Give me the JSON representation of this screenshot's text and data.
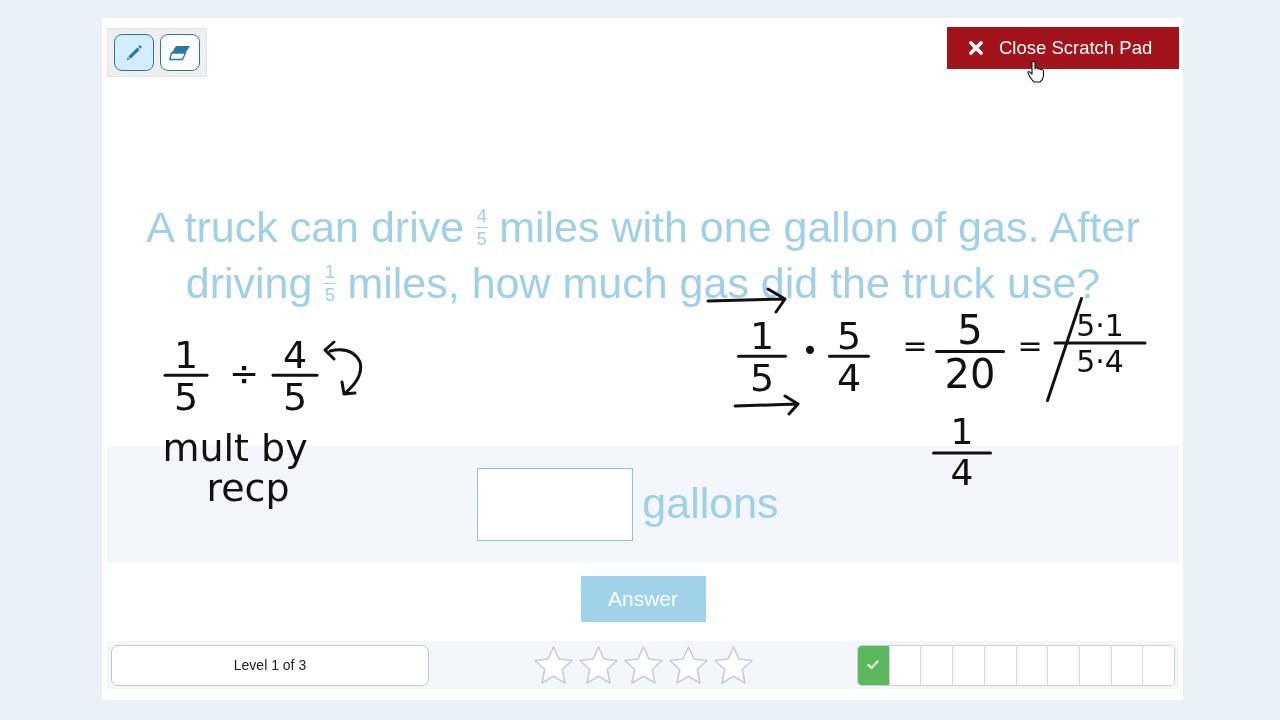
{
  "toolbar": {
    "tools": [
      {
        "kind": "pencil",
        "selected": true
      },
      {
        "kind": "eraser",
        "selected": false
      }
    ]
  },
  "close_button": {
    "label": "Close Scratch Pad"
  },
  "question": [
    {
      "kind": "text",
      "text": "A truck can drive"
    },
    {
      "kind": "fraction",
      "numerator": "4",
      "denominator": "5"
    },
    {
      "kind": "text",
      "text": "miles with one gallon of gas. After driving"
    },
    {
      "kind": "fraction",
      "numerator": "1",
      "denominator": "5"
    },
    {
      "kind": "text",
      "text": "miles, how much gas did the truck use?"
    }
  ],
  "scratch_work": [
    {
      "kind": "fraction",
      "numerator": "1",
      "denominator": "5"
    },
    {
      "kind": "symbol",
      "text": "÷"
    },
    {
      "kind": "fraction",
      "numerator": "4",
      "denominator": "5"
    },
    {
      "kind": "note",
      "text": "mult by"
    },
    {
      "kind": "note",
      "text": "recp"
    },
    {
      "kind": "fraction",
      "numerator": "1",
      "denominator": "5"
    },
    {
      "kind": "symbol",
      "text": "•"
    },
    {
      "kind": "fraction",
      "numerator": "5",
      "denominator": "4"
    },
    {
      "kind": "symbol",
      "text": "="
    },
    {
      "kind": "fraction",
      "numerator": "5",
      "denominator": "20"
    },
    {
      "kind": "symbol",
      "text": "="
    },
    {
      "kind": "fraction",
      "numerator": "5·1",
      "denominator": "5·4",
      "crossed_out": true
    },
    {
      "kind": "fraction",
      "numerator": "1",
      "denominator": "4"
    }
  ],
  "answer": {
    "unit": "gallons",
    "button": "Answer"
  },
  "level_label": "Level 1 of 3",
  "rating": {
    "stars": 0
  },
  "progress": [
    {
      "done": true
    },
    {
      "done": false
    },
    {
      "done": false
    },
    {
      "done": false
    },
    {
      "done": false
    },
    {
      "done": false
    },
    {
      "done": false
    },
    {
      "done": false
    },
    {
      "done": false
    },
    {
      "done": false
    }
  ]
}
